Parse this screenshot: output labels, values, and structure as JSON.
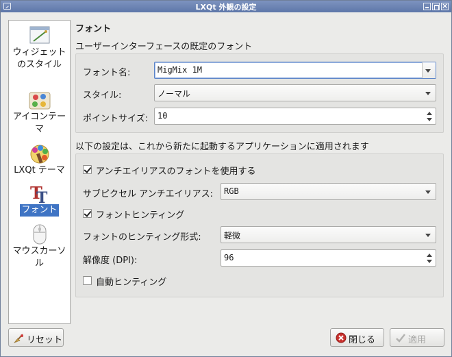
{
  "window": {
    "title": "LXQt 外観の設定"
  },
  "sidebar": {
    "items": [
      {
        "label_line1": "ウィジェット",
        "label_line2": "のスタイル",
        "icon": "widget-style-icon"
      },
      {
        "label_line1": "アイコンテー",
        "label_line2": "マ",
        "icon": "icon-theme-icon"
      },
      {
        "label_line1": "LXQt テーマ",
        "icon": "lxqt-theme-icon"
      },
      {
        "label_line1": "フォント",
        "icon": "font-icon",
        "active": true
      },
      {
        "label_line1": "マウスカーソ",
        "label_line2": "ル",
        "icon": "mouse-cursor-icon"
      }
    ]
  },
  "main": {
    "heading": "フォント",
    "default_font_section": "ユーザーインターフェースの既定のフォント",
    "font_name_label": "フォント名:",
    "font_name_value": "MigMix 1M",
    "style_label": "スタイル:",
    "style_value": "ノーマル",
    "point_size_label": "ポイントサイズ:",
    "point_size_value": "10",
    "apps_section": "以下の設定は、これから新たに起動するアプリケーションに適用されます",
    "antialias_label": "アンチエイリアスのフォントを使用する",
    "antialias_checked": true,
    "subpixel_label": "サブピクセル アンチエイリアス:",
    "subpixel_value": "RGB",
    "hinting_label": "フォントヒンティング",
    "hinting_checked": true,
    "hint_style_label": "フォントのヒンティング形式:",
    "hint_style_value": "軽微",
    "dpi_label": "解像度 (DPI):",
    "dpi_value": "96",
    "autohint_label": "自動ヒンティング",
    "autohint_checked": false
  },
  "footer": {
    "reset_label": "リセット",
    "close_label": "閉じる",
    "apply_label": "適用"
  },
  "colors": {
    "titlebar": "#6a82b3",
    "selection": "#3f74c4"
  }
}
